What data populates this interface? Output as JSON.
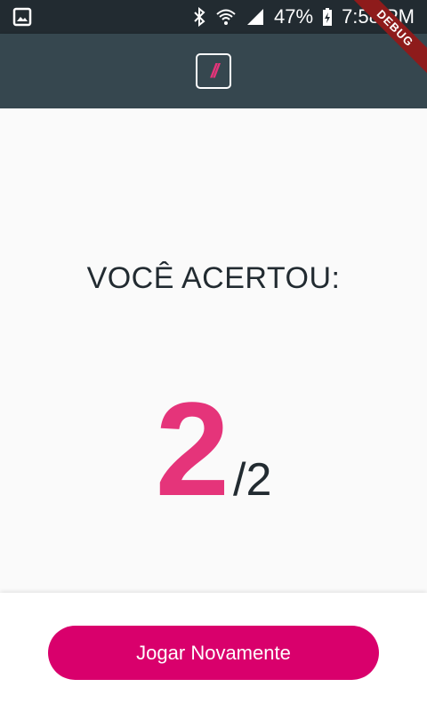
{
  "status_bar": {
    "battery": "47%",
    "time": "7:58 PM",
    "icons": [
      "image-icon",
      "bluetooth-icon",
      "wifi-icon",
      "signal-icon",
      "battery-charging-icon"
    ]
  },
  "app_bar": {
    "logo_text": "//",
    "debug_label": "DEBUG"
  },
  "result": {
    "title": "VOCÊ ACERTOU:",
    "score": "2",
    "total": "/2"
  },
  "actions": {
    "play_again_label": "Jogar Novamente"
  },
  "colors": {
    "status_bar": "#222b31",
    "app_bar": "#36474f",
    "accent": "#e5347a",
    "button": "#d9006c",
    "text": "#222b31",
    "background": "#fafafa"
  }
}
